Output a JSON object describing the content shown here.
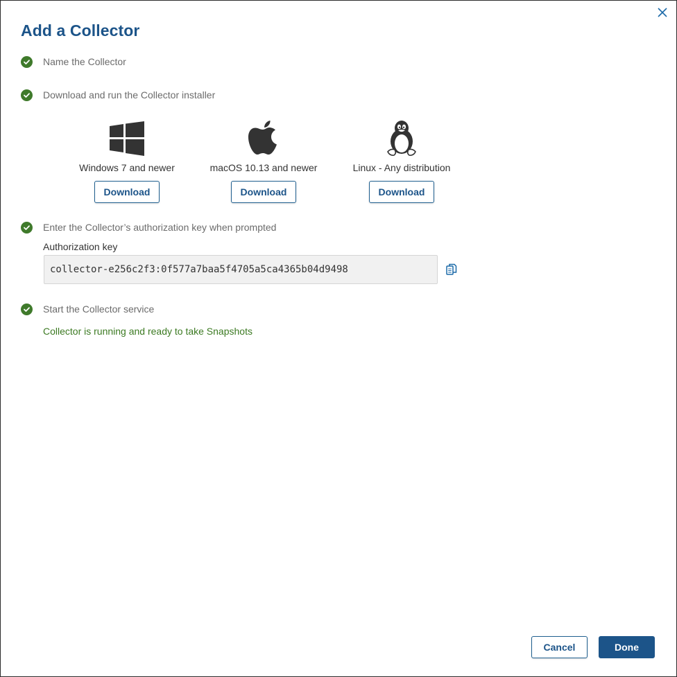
{
  "dialog": {
    "title": "Add a Collector"
  },
  "steps": [
    {
      "label": "Name the Collector"
    },
    {
      "label": "Download and run the Collector installer"
    },
    {
      "label": "Enter the Collector’s authorization key when prompted"
    },
    {
      "label": "Start the Collector service"
    }
  ],
  "downloads": [
    {
      "os": "Windows 7 and newer",
      "icon": "windows-icon",
      "button": "Download"
    },
    {
      "os": "macOS 10.13 and newer",
      "icon": "apple-icon",
      "button": "Download"
    },
    {
      "os": "Linux - Any distribution",
      "icon": "linux-tux-icon",
      "button": "Download"
    }
  ],
  "auth": {
    "label": "Authorization key",
    "value": "collector-e256c2f3:0f577a7baa5f4705a5ca4365b04d9498"
  },
  "status": {
    "text": "Collector is running and ready to take Snapshots"
  },
  "footer": {
    "cancel": "Cancel",
    "done": "Done"
  },
  "colors": {
    "title": "#1c5489",
    "check": "#3f7a2b",
    "status": "#3c7a22",
    "primary": "#1c5489"
  }
}
